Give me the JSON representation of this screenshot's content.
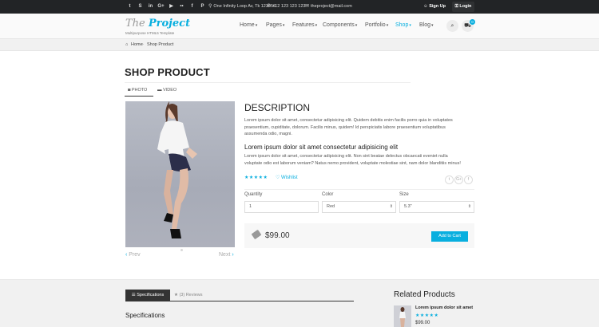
{
  "topbar": {
    "socials": [
      {
        "icon": "twitter-icon",
        "glyph": "t"
      },
      {
        "icon": "skype-icon",
        "glyph": "S"
      },
      {
        "icon": "linkedin-icon",
        "glyph": "in"
      },
      {
        "icon": "google-plus-icon",
        "glyph": "G+"
      },
      {
        "icon": "youtube-icon",
        "glyph": "▶"
      },
      {
        "icon": "flickr-icon",
        "glyph": "••"
      },
      {
        "icon": "facebook-icon",
        "glyph": "f"
      },
      {
        "icon": "pinterest-icon",
        "glyph": "P"
      }
    ],
    "address": "One Infinity Loop Av, Tk 123456",
    "phone": "+12 123 123 123",
    "email": "theproject@mail.com",
    "signup": "Sign Up",
    "login": "Login"
  },
  "header": {
    "logo_prefix": "The",
    "logo_main": "Project",
    "tagline": "Multipurpose HTML5 Template",
    "nav": [
      "Home",
      "Pages",
      "Features",
      "Components",
      "Portfolio",
      "Shop",
      "Blog"
    ],
    "active_nav": "Shop",
    "cart_count": "0"
  },
  "breadcrumb": {
    "home": "Home",
    "current": "Shop Product"
  },
  "page": {
    "title": "SHOP PRODUCT"
  },
  "media_tabs": {
    "photo": "PHOTO",
    "video": "VIDEO"
  },
  "carousel": {
    "prev": "Prev",
    "next": "Next"
  },
  "product": {
    "description_heading": "DESCRIPTION",
    "para1_lines": [
      "Lorem ipsum dolor sit amet, consectetur adipisicing elit. Quidem debitis enim facilis porro quia in voluptates",
      "praesentium, cupiditate, dolorum. Facilis minus, quidem! Id perspiciatis labore praesentium voluptatibus",
      "assumenda odio, magni."
    ],
    "subheading": "Lorem ipsum dolor sit amet consectetur adipisicing elit",
    "para2_lines": [
      "Lorem ipsum dolor sit amet, consectetur adipisicing elit. Non sint beatae delectus obcaecati eveniet nulla",
      "voluptate odio est laborum veniam? Natus nemo provident, voluptate molestiae sint, nam dolor blanditiis minus!"
    ],
    "rating": 5,
    "stars": "★★★★★",
    "wishlist": "♡ Wishlist",
    "share": [
      "t",
      "G+",
      "f"
    ],
    "quantity_label": "Quantity",
    "quantity_value": "1",
    "color_label": "Color",
    "color_value": "Red",
    "size_label": "Size",
    "size_value": "5.3\"",
    "price": "$99.00",
    "add_to_cart": "Add to Cart"
  },
  "lower": {
    "tab_specs": "Specifications",
    "tab_reviews": "★ (3) Reviews",
    "specs_heading": "Specifications",
    "related_heading": "Related Products",
    "related_item": {
      "name": "Lorem ipsum dolor sit amet",
      "stars": "★★★★★",
      "price": "$99.00"
    }
  }
}
